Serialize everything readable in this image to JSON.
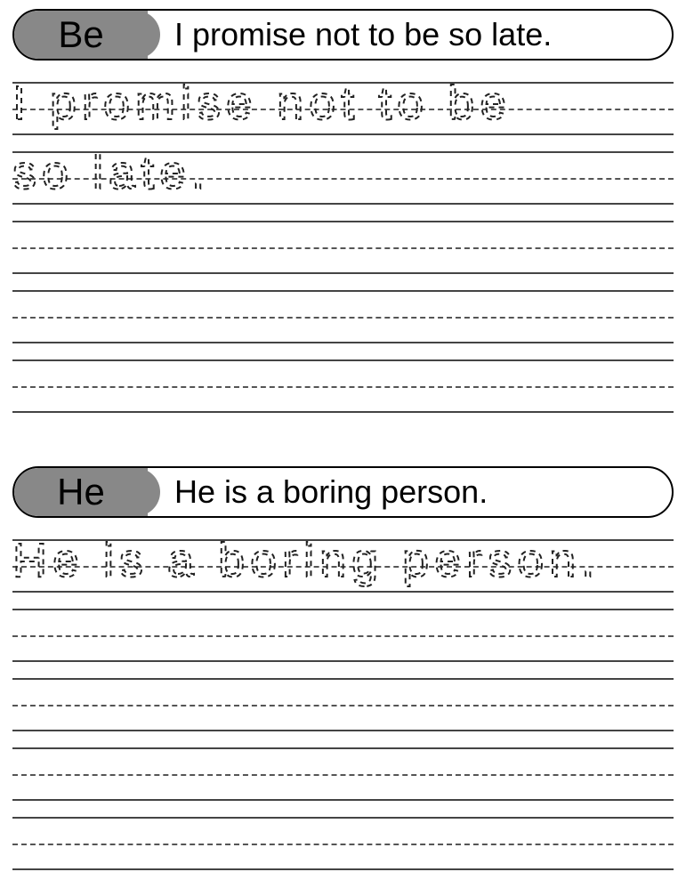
{
  "sections": [
    {
      "word_label": "Be",
      "sentence": "I promise not to be so late.",
      "trace_lines": [
        "I promise not to be",
        "so late."
      ],
      "blank_lines": 3
    },
    {
      "word_label": "He",
      "sentence": "He is a boring person.",
      "trace_lines": [
        "He is a boring person."
      ],
      "blank_lines": 4
    }
  ],
  "colors": {
    "pill_bg": "#888888",
    "line_color": "#444444",
    "trace_color": "#222222"
  }
}
